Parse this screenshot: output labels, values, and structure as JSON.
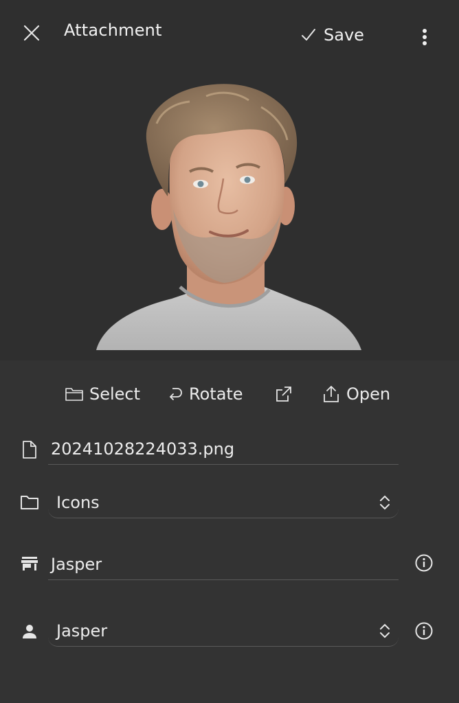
{
  "header": {
    "title": "Attachment",
    "save_label": "Save"
  },
  "actions": {
    "select_label": "Select",
    "rotate_label": "Rotate",
    "open_label": "Open"
  },
  "fields": {
    "filename": "20241028224033.png",
    "folder": "Icons",
    "store": "Jasper",
    "person": "Jasper"
  },
  "colors": {
    "background": "#333333",
    "surface": "#2f2f2f",
    "text": "#ececec"
  }
}
